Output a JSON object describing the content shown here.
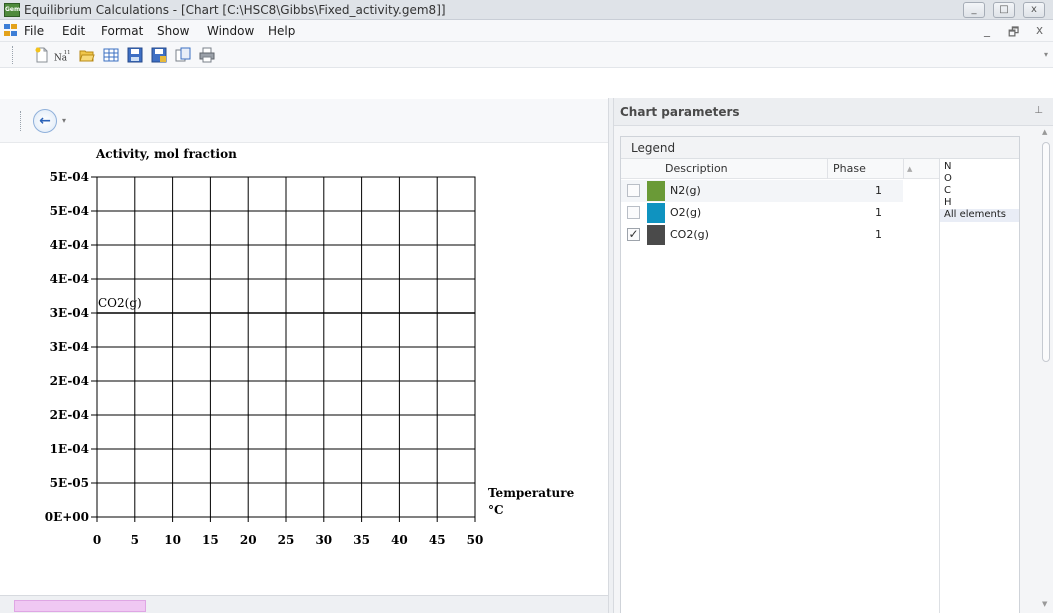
{
  "window": {
    "app_icon_text": "Gem",
    "title": "Equilibrium Calculations - [Chart [C:\\HSC8\\Gibbs\\Fixed_activity.gem8]]",
    "controls": {
      "minimize": "_",
      "maximize": "□",
      "close": "x"
    }
  },
  "menu": {
    "items": [
      "File",
      "Edit",
      "Format",
      "Show",
      "Window",
      "Help"
    ],
    "mdi_minimize": "_",
    "mdi_restore": "🗗",
    "mdi_close": "x"
  },
  "toolbar": {
    "icons": [
      "new-file-icon",
      "elements-icon",
      "open-folder-icon",
      "table-icon",
      "save-icon",
      "save-as-icon",
      "copy-icon",
      "print-icon"
    ],
    "elements_icon_text": "Na",
    "overflow": "▾"
  },
  "navigation": {
    "back_symbol": "←",
    "dropdown_symbol": "▾"
  },
  "chart_data": {
    "type": "line",
    "title": "",
    "ylabel": "Activity, mol fraction",
    "xlabel_line1": "Temperature",
    "xlabel_line2": "°C",
    "x_ticks": [
      0,
      5,
      10,
      15,
      20,
      25,
      30,
      35,
      40,
      45,
      50
    ],
    "y_tick_labels": [
      "0E+00",
      "5E-05",
      "1E-04",
      "2E-04",
      "2E-04",
      "3E-04",
      "3E-04",
      "4E-04",
      "4E-04",
      "5E-04",
      "5E-04"
    ],
    "xlim": [
      0,
      50
    ],
    "ylim": [
      0,
      0.0005
    ],
    "grid": true,
    "series": [
      {
        "name": "CO2(g)",
        "x": [
          0,
          50
        ],
        "y": [
          0.0003,
          0.0003
        ],
        "color": "#000000"
      }
    ]
  },
  "panel": {
    "title": "Chart parameters",
    "pin": "📌",
    "legend_title": "Legend",
    "columns": {
      "description": "Description",
      "phase": "Phase"
    },
    "rows": [
      {
        "checked": false,
        "check_mark": "",
        "color": "#6a9a37",
        "description": "N2(g)",
        "phase": "1"
      },
      {
        "checked": false,
        "check_mark": "",
        "color": "#0f93c0",
        "description": "O2(g)",
        "phase": "1"
      },
      {
        "checked": true,
        "check_mark": "✓",
        "color": "#4a4a4a",
        "description": "CO2(g)",
        "phase": "1"
      }
    ],
    "elements": [
      "N",
      "O",
      "C",
      "H",
      "All elements"
    ],
    "selected_element": "All elements"
  }
}
